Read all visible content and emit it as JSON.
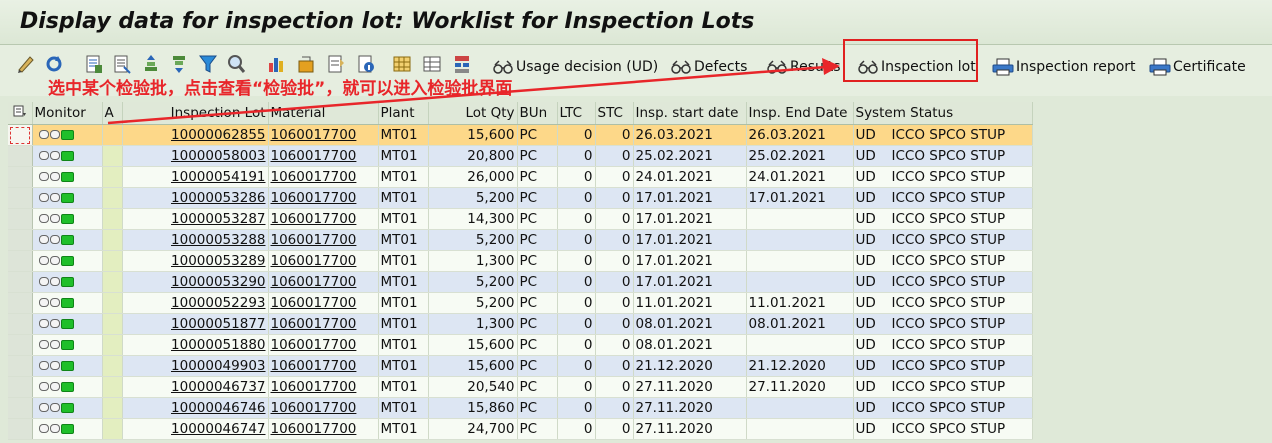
{
  "title": "Display data for inspection lot: Worklist for Inspection Lots",
  "toolbar": {
    "usage_decision": "Usage decision (UD)",
    "defects": "Defects",
    "results": "Results",
    "inspection_lot": "Inspection lot",
    "inspection_report": "Inspection report",
    "certificate": "Certificate"
  },
  "annotation": "选中某个检验批，点击查看“检验批”，就可以进入检验批界面",
  "columns": {
    "monitor": "Monitor",
    "a": "A",
    "inspection_lot": "Inspection Lot",
    "material": "Material",
    "plant": "Plant",
    "lot_qty": "Lot Qty",
    "bun": "BUn",
    "ltc": "LTC",
    "stc": "STC",
    "start_date": "Insp. start date",
    "end_date": "Insp. End Date",
    "system_status": "System Status"
  },
  "rows": [
    {
      "lot": "10000062855",
      "material": "1060017700",
      "plant": "MT01",
      "qty": "15,600",
      "bun": "PC",
      "ltc": "0",
      "stc": "0",
      "start": "26.03.2021",
      "end": "26.03.2021",
      "ud": "UD",
      "status": "ICCO SPCO STUP"
    },
    {
      "lot": "10000058003",
      "material": "1060017700",
      "plant": "MT01",
      "qty": "20,800",
      "bun": "PC",
      "ltc": "0",
      "stc": "0",
      "start": "25.02.2021",
      "end": "25.02.2021",
      "ud": "UD",
      "status": "ICCO SPCO STUP"
    },
    {
      "lot": "10000054191",
      "material": "1060017700",
      "plant": "MT01",
      "qty": "26,000",
      "bun": "PC",
      "ltc": "0",
      "stc": "0",
      "start": "24.01.2021",
      "end": "24.01.2021",
      "ud": "UD",
      "status": "ICCO SPCO STUP"
    },
    {
      "lot": "10000053286",
      "material": "1060017700",
      "plant": "MT01",
      "qty": "5,200",
      "bun": "PC",
      "ltc": "0",
      "stc": "0",
      "start": "17.01.2021",
      "end": "17.01.2021",
      "ud": "UD",
      "status": "ICCO SPCO STUP"
    },
    {
      "lot": "10000053287",
      "material": "1060017700",
      "plant": "MT01",
      "qty": "14,300",
      "bun": "PC",
      "ltc": "0",
      "stc": "0",
      "start": "17.01.2021",
      "end": "",
      "ud": "UD",
      "status": "ICCO SPCO STUP"
    },
    {
      "lot": "10000053288",
      "material": "1060017700",
      "plant": "MT01",
      "qty": "5,200",
      "bun": "PC",
      "ltc": "0",
      "stc": "0",
      "start": "17.01.2021",
      "end": "",
      "ud": "UD",
      "status": "ICCO SPCO STUP"
    },
    {
      "lot": "10000053289",
      "material": "1060017700",
      "plant": "MT01",
      "qty": "1,300",
      "bun": "PC",
      "ltc": "0",
      "stc": "0",
      "start": "17.01.2021",
      "end": "",
      "ud": "UD",
      "status": "ICCO SPCO STUP"
    },
    {
      "lot": "10000053290",
      "material": "1060017700",
      "plant": "MT01",
      "qty": "5,200",
      "bun": "PC",
      "ltc": "0",
      "stc": "0",
      "start": "17.01.2021",
      "end": "",
      "ud": "UD",
      "status": "ICCO SPCO STUP"
    },
    {
      "lot": "10000052293",
      "material": "1060017700",
      "plant": "MT01",
      "qty": "5,200",
      "bun": "PC",
      "ltc": "0",
      "stc": "0",
      "start": "11.01.2021",
      "end": "11.01.2021",
      "ud": "UD",
      "status": "ICCO SPCO STUP"
    },
    {
      "lot": "10000051877",
      "material": "1060017700",
      "plant": "MT01",
      "qty": "1,300",
      "bun": "PC",
      "ltc": "0",
      "stc": "0",
      "start": "08.01.2021",
      "end": "08.01.2021",
      "ud": "UD",
      "status": "ICCO SPCO STUP"
    },
    {
      "lot": "10000051880",
      "material": "1060017700",
      "plant": "MT01",
      "qty": "15,600",
      "bun": "PC",
      "ltc": "0",
      "stc": "0",
      "start": "08.01.2021",
      "end": "",
      "ud": "UD",
      "status": "ICCO SPCO STUP"
    },
    {
      "lot": "10000049903",
      "material": "1060017700",
      "plant": "MT01",
      "qty": "15,600",
      "bun": "PC",
      "ltc": "0",
      "stc": "0",
      "start": "21.12.2020",
      "end": "21.12.2020",
      "ud": "UD",
      "status": "ICCO SPCO STUP"
    },
    {
      "lot": "10000046737",
      "material": "1060017700",
      "plant": "MT01",
      "qty": "20,540",
      "bun": "PC",
      "ltc": "0",
      "stc": "0",
      "start": "27.11.2020",
      "end": "27.11.2020",
      "ud": "UD",
      "status": "ICCO SPCO STUP"
    },
    {
      "lot": "10000046746",
      "material": "1060017700",
      "plant": "MT01",
      "qty": "15,860",
      "bun": "PC",
      "ltc": "0",
      "stc": "0",
      "start": "27.11.2020",
      "end": "",
      "ud": "UD",
      "status": "ICCO SPCO STUP"
    },
    {
      "lot": "10000046747",
      "material": "1060017700",
      "plant": "MT01",
      "qty": "24,700",
      "bun": "PC",
      "ltc": "0",
      "stc": "0",
      "start": "27.11.2020",
      "end": "",
      "ud": "UD",
      "status": "ICCO SPCO STUP"
    }
  ],
  "colors": {
    "selected_row": "#fdd889",
    "alt_row": "#dde6f3",
    "annotation": "#e8262a"
  }
}
